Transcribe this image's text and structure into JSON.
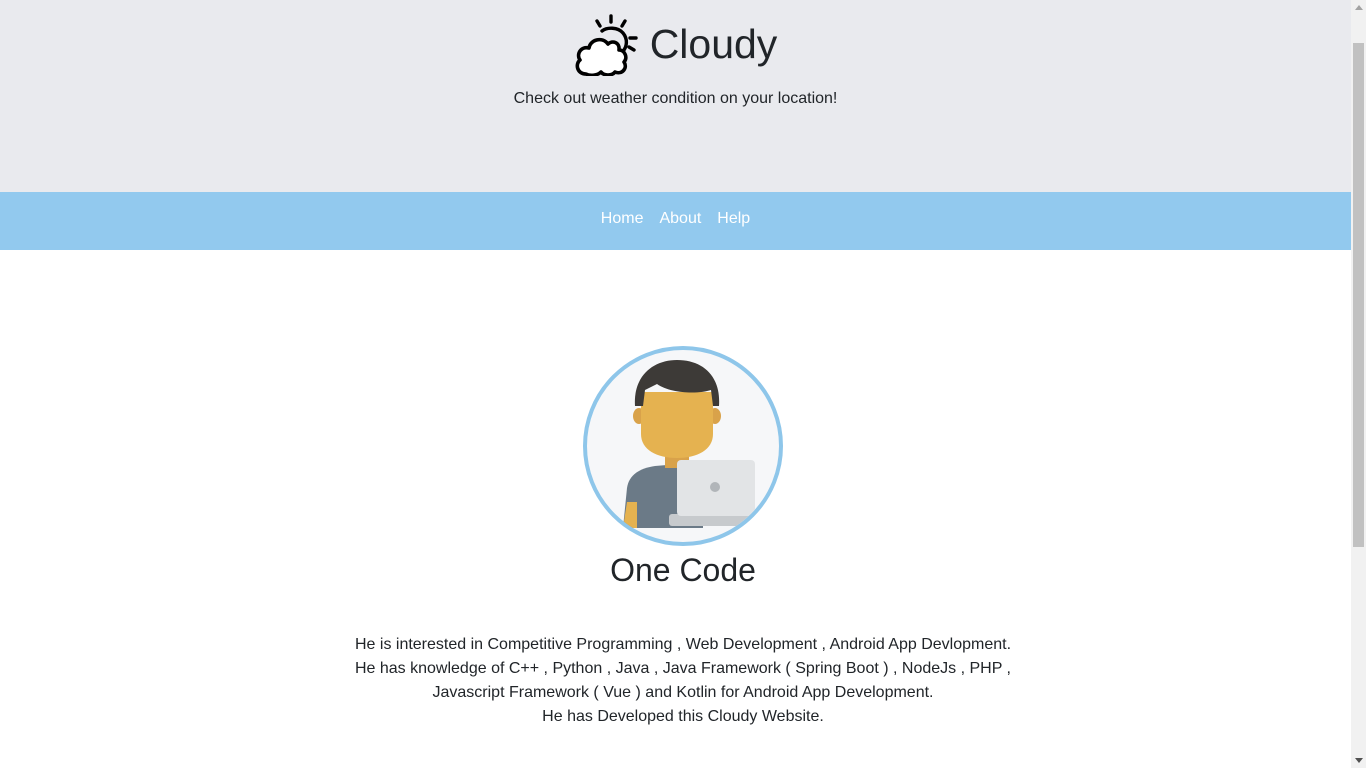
{
  "header": {
    "title": "Cloudy",
    "tagline": "Check out weather condition on your location!",
    "logo_icon": "cloud-sun-icon"
  },
  "nav": {
    "items": [
      {
        "label": "Home"
      },
      {
        "label": "About"
      },
      {
        "label": "Help"
      }
    ]
  },
  "profile": {
    "avatar_icon": "developer-avatar",
    "name": "One Code",
    "bio": [
      "He is interested in Competitive Programming , Web Development , Android App Devlopment.",
      "He has knowledge of C++ , Python , Java , Java Framework ( Spring Boot ) , NodeJs , PHP ,",
      "Javascript Framework ( Vue ) and Kotlin for Android App Development.",
      "He has Developed this Cloudy Website."
    ]
  },
  "colors": {
    "header_bg": "#e9eaee",
    "nav_bg": "#92c9ee",
    "avatar_border": "#8ec6ea",
    "text": "#212529"
  }
}
